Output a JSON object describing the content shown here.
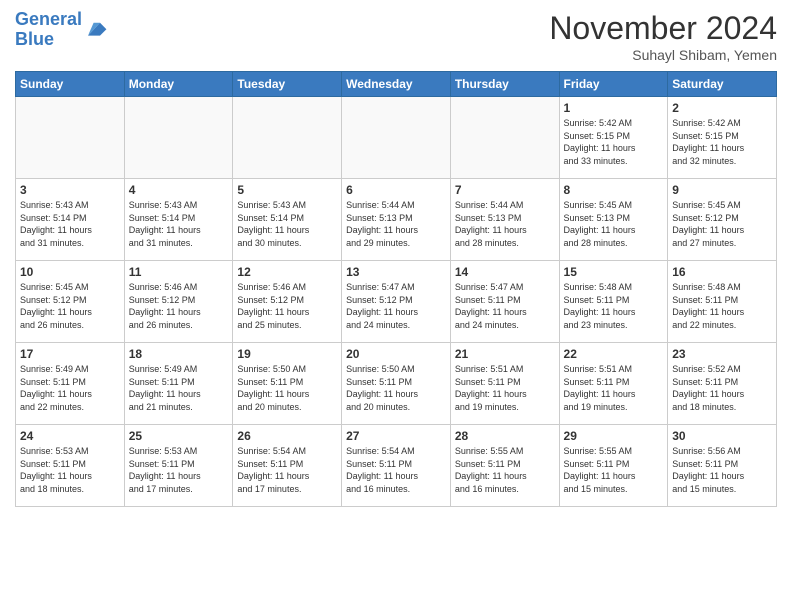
{
  "header": {
    "logo_line1": "General",
    "logo_line2": "Blue",
    "month": "November 2024",
    "location": "Suhayl Shibam, Yemen"
  },
  "weekdays": [
    "Sunday",
    "Monday",
    "Tuesday",
    "Wednesday",
    "Thursday",
    "Friday",
    "Saturday"
  ],
  "weeks": [
    [
      {
        "day": "",
        "info": ""
      },
      {
        "day": "",
        "info": ""
      },
      {
        "day": "",
        "info": ""
      },
      {
        "day": "",
        "info": ""
      },
      {
        "day": "",
        "info": ""
      },
      {
        "day": "1",
        "info": "Sunrise: 5:42 AM\nSunset: 5:15 PM\nDaylight: 11 hours\nand 33 minutes."
      },
      {
        "day": "2",
        "info": "Sunrise: 5:42 AM\nSunset: 5:15 PM\nDaylight: 11 hours\nand 32 minutes."
      }
    ],
    [
      {
        "day": "3",
        "info": "Sunrise: 5:43 AM\nSunset: 5:14 PM\nDaylight: 11 hours\nand 31 minutes."
      },
      {
        "day": "4",
        "info": "Sunrise: 5:43 AM\nSunset: 5:14 PM\nDaylight: 11 hours\nand 31 minutes."
      },
      {
        "day": "5",
        "info": "Sunrise: 5:43 AM\nSunset: 5:14 PM\nDaylight: 11 hours\nand 30 minutes."
      },
      {
        "day": "6",
        "info": "Sunrise: 5:44 AM\nSunset: 5:13 PM\nDaylight: 11 hours\nand 29 minutes."
      },
      {
        "day": "7",
        "info": "Sunrise: 5:44 AM\nSunset: 5:13 PM\nDaylight: 11 hours\nand 28 minutes."
      },
      {
        "day": "8",
        "info": "Sunrise: 5:45 AM\nSunset: 5:13 PM\nDaylight: 11 hours\nand 28 minutes."
      },
      {
        "day": "9",
        "info": "Sunrise: 5:45 AM\nSunset: 5:12 PM\nDaylight: 11 hours\nand 27 minutes."
      }
    ],
    [
      {
        "day": "10",
        "info": "Sunrise: 5:45 AM\nSunset: 5:12 PM\nDaylight: 11 hours\nand 26 minutes."
      },
      {
        "day": "11",
        "info": "Sunrise: 5:46 AM\nSunset: 5:12 PM\nDaylight: 11 hours\nand 26 minutes."
      },
      {
        "day": "12",
        "info": "Sunrise: 5:46 AM\nSunset: 5:12 PM\nDaylight: 11 hours\nand 25 minutes."
      },
      {
        "day": "13",
        "info": "Sunrise: 5:47 AM\nSunset: 5:12 PM\nDaylight: 11 hours\nand 24 minutes."
      },
      {
        "day": "14",
        "info": "Sunrise: 5:47 AM\nSunset: 5:11 PM\nDaylight: 11 hours\nand 24 minutes."
      },
      {
        "day": "15",
        "info": "Sunrise: 5:48 AM\nSunset: 5:11 PM\nDaylight: 11 hours\nand 23 minutes."
      },
      {
        "day": "16",
        "info": "Sunrise: 5:48 AM\nSunset: 5:11 PM\nDaylight: 11 hours\nand 22 minutes."
      }
    ],
    [
      {
        "day": "17",
        "info": "Sunrise: 5:49 AM\nSunset: 5:11 PM\nDaylight: 11 hours\nand 22 minutes."
      },
      {
        "day": "18",
        "info": "Sunrise: 5:49 AM\nSunset: 5:11 PM\nDaylight: 11 hours\nand 21 minutes."
      },
      {
        "day": "19",
        "info": "Sunrise: 5:50 AM\nSunset: 5:11 PM\nDaylight: 11 hours\nand 20 minutes."
      },
      {
        "day": "20",
        "info": "Sunrise: 5:50 AM\nSunset: 5:11 PM\nDaylight: 11 hours\nand 20 minutes."
      },
      {
        "day": "21",
        "info": "Sunrise: 5:51 AM\nSunset: 5:11 PM\nDaylight: 11 hours\nand 19 minutes."
      },
      {
        "day": "22",
        "info": "Sunrise: 5:51 AM\nSunset: 5:11 PM\nDaylight: 11 hours\nand 19 minutes."
      },
      {
        "day": "23",
        "info": "Sunrise: 5:52 AM\nSunset: 5:11 PM\nDaylight: 11 hours\nand 18 minutes."
      }
    ],
    [
      {
        "day": "24",
        "info": "Sunrise: 5:53 AM\nSunset: 5:11 PM\nDaylight: 11 hours\nand 18 minutes."
      },
      {
        "day": "25",
        "info": "Sunrise: 5:53 AM\nSunset: 5:11 PM\nDaylight: 11 hours\nand 17 minutes."
      },
      {
        "day": "26",
        "info": "Sunrise: 5:54 AM\nSunset: 5:11 PM\nDaylight: 11 hours\nand 17 minutes."
      },
      {
        "day": "27",
        "info": "Sunrise: 5:54 AM\nSunset: 5:11 PM\nDaylight: 11 hours\nand 16 minutes."
      },
      {
        "day": "28",
        "info": "Sunrise: 5:55 AM\nSunset: 5:11 PM\nDaylight: 11 hours\nand 16 minutes."
      },
      {
        "day": "29",
        "info": "Sunrise: 5:55 AM\nSunset: 5:11 PM\nDaylight: 11 hours\nand 15 minutes."
      },
      {
        "day": "30",
        "info": "Sunrise: 5:56 AM\nSunset: 5:11 PM\nDaylight: 11 hours\nand 15 minutes."
      }
    ]
  ]
}
